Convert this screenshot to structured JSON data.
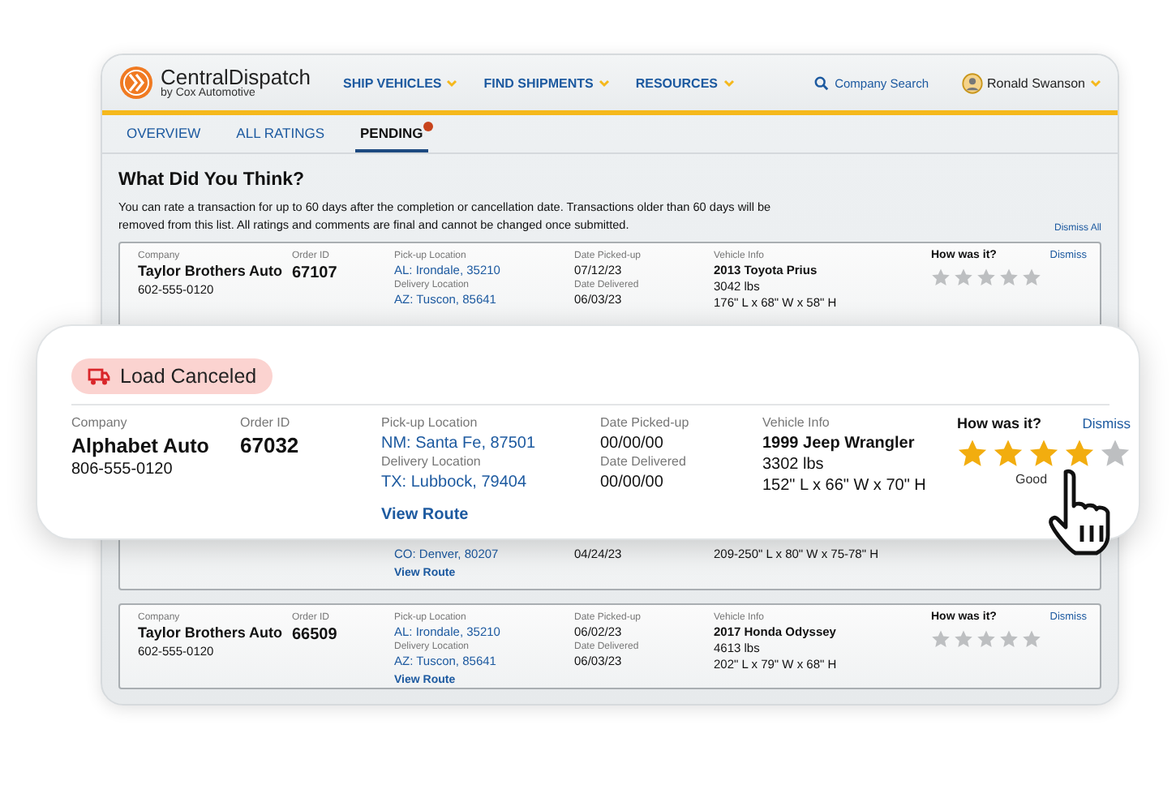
{
  "header": {
    "brand": "CentralDispatch",
    "brand_sub": "by Cox Automotive",
    "nav": [
      {
        "label": "SHIP VEHICLES"
      },
      {
        "label": "FIND SHIPMENTS"
      },
      {
        "label": "RESOURCES"
      }
    ],
    "search": "Company Search",
    "user": "Ronald Swanson"
  },
  "tabs": [
    {
      "label": "OVERVIEW",
      "selected": false,
      "badge": false
    },
    {
      "label": "ALL RATINGS",
      "selected": false,
      "badge": false
    },
    {
      "label": "PENDING",
      "selected": true,
      "badge": true
    }
  ],
  "heading": "What Did You Think?",
  "intro": "You can rate a transaction for up to 60 days after the completion or cancellation date. Transactions older than 60 days will be removed from this list. All ratings and comments are final and cannot be changed once submitted.",
  "dismiss_all": "Dismiss All",
  "rows": [
    {
      "company_label": "Company",
      "company": "Taylor Brothers Auto",
      "phone": "602-555-0120",
      "order_label": "Order ID",
      "order_id": "67107",
      "pickup_label": "Pick-up Location",
      "pickup": "AL: Irondale, 35210",
      "delivery_label": "Delivery Location",
      "delivery": "AZ: Tuscon, 85641",
      "picked_label": "Date Picked-up",
      "picked": "07/12/23",
      "delivered_label": "Date Delivered",
      "delivered": "06/03/23",
      "vehicle_label": "Vehicle Info",
      "vehicle": "2013 Toyota Prius",
      "weight": "3042 lbs",
      "dims": "176\" L x 68\" W x 58\" H",
      "rating_label": "How was it?",
      "dismiss": "Dismiss",
      "stars": 0
    },
    {
      "delivery": "CO: Denver, 80207",
      "delivered": "04/24/23",
      "dims": "209-250\" L x 80\" W x 75-78\" H",
      "view_route": "View Route"
    },
    {
      "company_label": "Company",
      "company": "Taylor Brothers Auto",
      "phone": "602-555-0120",
      "order_label": "Order ID",
      "order_id": "66509",
      "pickup_label": "Pick-up Location",
      "pickup": "AL: Irondale, 35210",
      "delivery_label": "Delivery Location",
      "delivery": "AZ: Tuscon, 85641",
      "picked_label": "Date Picked-up",
      "picked": "06/02/23",
      "delivered_label": "Date Delivered",
      "delivered": "06/03/23",
      "vehicle_label": "Vehicle Info",
      "vehicle": "2017 Honda Odyssey",
      "weight": "4613 lbs",
      "dims": "202\" L x 79\" W x 68\" H",
      "rating_label": "How was it?",
      "dismiss": "Dismiss",
      "stars": 0,
      "view_route": "View Route"
    }
  ],
  "featured": {
    "status": "Load Canceled",
    "company_label": "Company",
    "company": "Alphabet Auto",
    "phone": "806-555-0120",
    "order_label": "Order ID",
    "order_id": "67032",
    "pickup_label": "Pick-up Location",
    "pickup": "NM: Santa Fe, 87501",
    "delivery_label": "Delivery Location",
    "delivery": "TX: Lubbock, 79404",
    "view_route": "View Route",
    "picked_label": "Date Picked-up",
    "picked": "00/00/00",
    "delivered_label": "Date Delivered",
    "delivered": "00/00/00",
    "vehicle_label": "Vehicle Info",
    "vehicle": "1999 Jeep Wrangler",
    "weight": "3302 lbs",
    "dims": "152\" L x 66\" W x 70\" H",
    "rating_label": "How was it?",
    "dismiss": "Dismiss",
    "stars": 4,
    "rating_text": "Good"
  }
}
